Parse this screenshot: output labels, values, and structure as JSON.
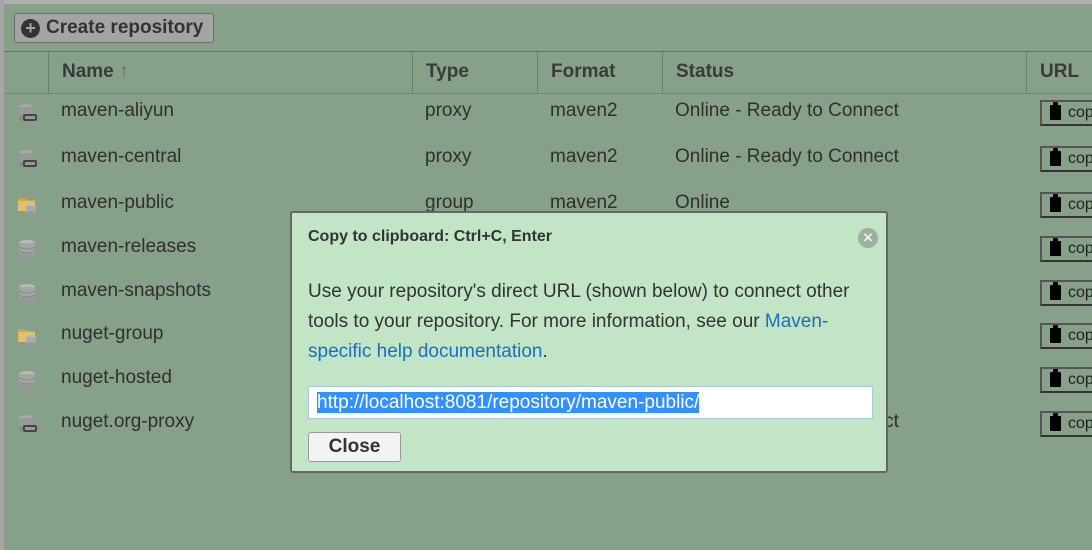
{
  "toolbar": {
    "create_label": "Create repository"
  },
  "columns": {
    "name": "Name",
    "sort_icon": "arrow-up-icon",
    "type": "Type",
    "format": "Format",
    "status": "Status",
    "url": "URL"
  },
  "copy_label": "copy",
  "rows": [
    {
      "icon": "proxy",
      "name": "maven-aliyun",
      "type": "proxy",
      "format": "maven2",
      "status": "Online - Ready to Connect"
    },
    {
      "icon": "proxy",
      "name": "maven-central",
      "type": "proxy",
      "format": "maven2",
      "status": "Online - Ready to Connect"
    },
    {
      "icon": "group",
      "name": "maven-public",
      "type": "group",
      "format": "maven2",
      "status": "Online"
    },
    {
      "icon": "hosted",
      "name": "maven-releases",
      "type": "",
      "format": "",
      "status": ""
    },
    {
      "icon": "hosted",
      "name": "maven-snapshots",
      "type": "",
      "format": "",
      "status": ""
    },
    {
      "icon": "group",
      "name": "nuget-group",
      "type": "",
      "format": "",
      "status": ""
    },
    {
      "icon": "hosted",
      "name": "nuget-hosted",
      "type": "",
      "format": "",
      "status": ""
    },
    {
      "icon": "proxy",
      "name": "nuget.org-proxy",
      "type": "",
      "format": "",
      "status": "Online - Ready to Connect"
    }
  ],
  "dialog": {
    "title": "Copy to clipboard: Ctrl+C, Enter",
    "text": "Use your repository's direct URL (shown below) to connect other tools to your repository. For more information, see our ",
    "link": "Maven-specific help documentation",
    "text_end": ".",
    "url": "http://localhost:8081/repository/maven-public/",
    "close_label": "Close"
  },
  "colors": {
    "background": "#87a08a",
    "dialog": "#c2e5c6",
    "link": "#1a6fc4",
    "selection": "#3390ff"
  }
}
